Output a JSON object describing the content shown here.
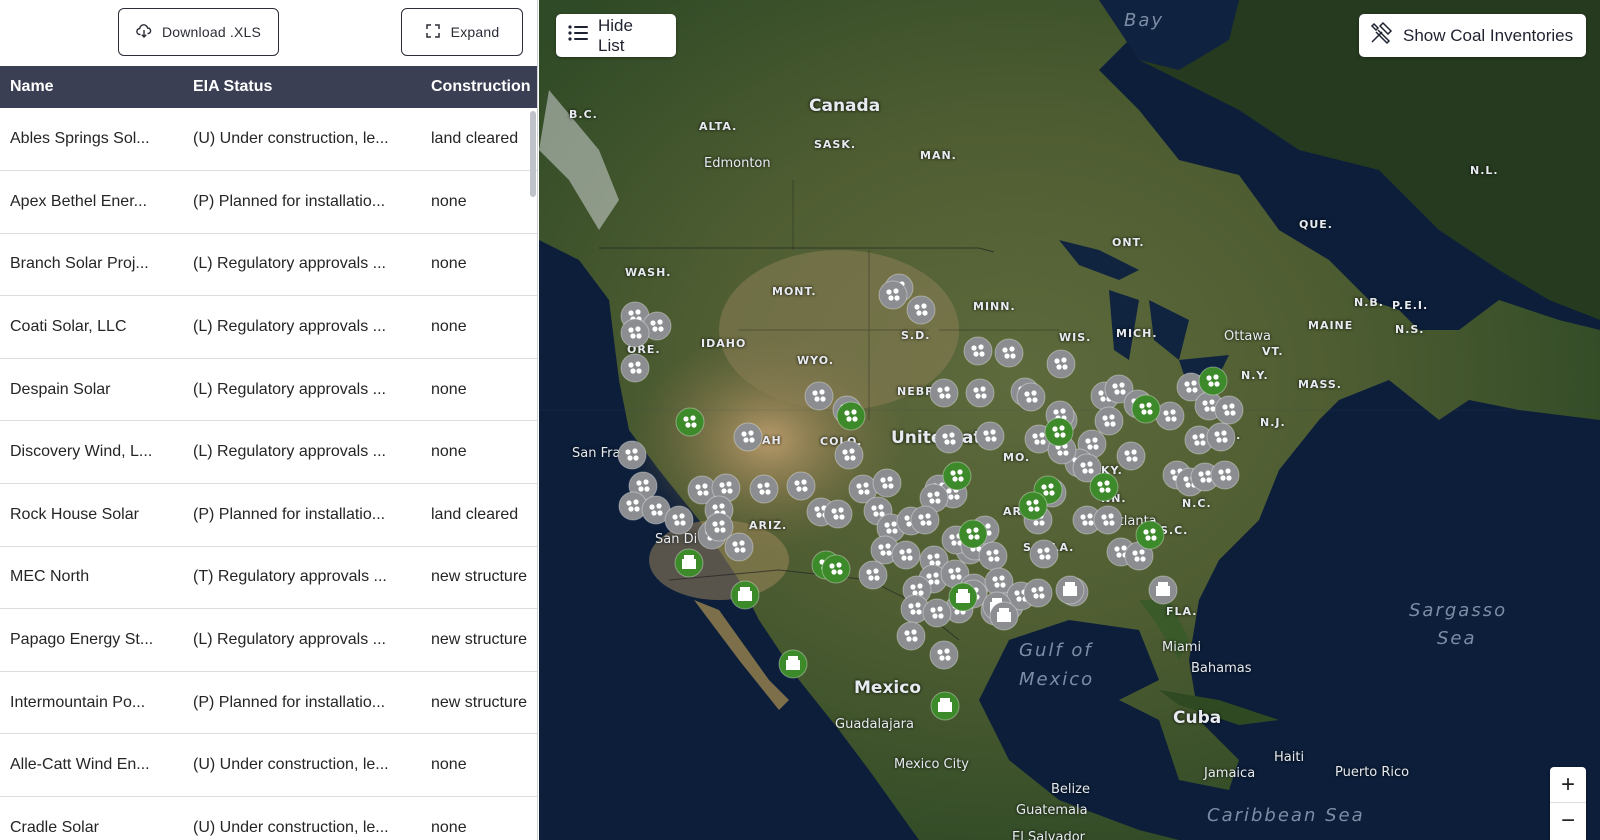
{
  "toolbar": {
    "download_label": "Download .XLS",
    "expand_label": "Expand"
  },
  "table": {
    "columns": [
      "Name",
      "EIA Status",
      "Construction"
    ],
    "rows": [
      {
        "name": "Ables Springs Sol...",
        "status": "(U) Under construction, le...",
        "construction": "land cleared"
      },
      {
        "name": "Apex Bethel Ener...",
        "status": "(P) Planned for installatio...",
        "construction": "none"
      },
      {
        "name": "Branch Solar Proj...",
        "status": "(L) Regulatory approvals ...",
        "construction": "none"
      },
      {
        "name": "Coati Solar, LLC",
        "status": "(L) Regulatory approvals ...",
        "construction": "none"
      },
      {
        "name": "Despain Solar",
        "status": "(L) Regulatory approvals ...",
        "construction": "none"
      },
      {
        "name": "Discovery Wind, L...",
        "status": "(L) Regulatory approvals ...",
        "construction": "none"
      },
      {
        "name": "Rock House Solar",
        "status": "(P) Planned for installatio...",
        "construction": "land cleared"
      },
      {
        "name": "MEC North",
        "status": "(T) Regulatory approvals ...",
        "construction": "new structure"
      },
      {
        "name": "Papago Energy St...",
        "status": "(L) Regulatory approvals ...",
        "construction": "new structure"
      },
      {
        "name": "Intermountain Po...",
        "status": "(P) Planned for installatio...",
        "construction": "new structure"
      },
      {
        "name": "Alle-Catt Wind En...",
        "status": "(U) Under construction, le...",
        "construction": "none"
      },
      {
        "name": "Cradle Solar",
        "status": "(U) Under construction, le...",
        "construction": "none"
      }
    ]
  },
  "map": {
    "hide_list_label": "Hide List",
    "coal_label": "Show Coal Inventories",
    "zoom_in": "+",
    "zoom_out": "−",
    "labels": {
      "bay": "Bay",
      "canada": "Canada",
      "bc": "B.C.",
      "alta": "ALTA.",
      "sask": "SASK.",
      "man": "MAN.",
      "edmonton": "Edmonton",
      "nl": "N.L.",
      "que": "QUE.",
      "ont": "ONT.",
      "wash": "WASH.",
      "mont": "MONT.",
      "idaho": "IDAHO",
      "ore": "ORE.",
      "wyo": "WYO.",
      "sd": "S.D.",
      "minn": "MINN.",
      "wis": "WIS.",
      "mich": "MICH.",
      "nebr": "NEBR",
      "colo": "COLO.",
      "utah": "AH",
      "united": "Unite",
      "states_tail": "at",
      "mo": "MO.",
      "ky": "KY.",
      "ny": "N.Y.",
      "mass": "MASS.",
      "vt": "VT.",
      "nb": "N.B.",
      "pei": "P.E.I.",
      "maine": "MAINE",
      "ns": "N.S.",
      "ottawa": "Ottawa",
      "nj": "N.J.",
      "md": "MD.",
      "nc": "N.C.",
      "sc": "S.C.",
      "tn": "NN.",
      "atlanta": "Atlanta",
      "ala": "S. ALA.",
      "ar": "AR",
      "ariz": "ARIZ.",
      "sanfran": "San Fra",
      "sandiego": "San Di",
      "fla": "FLA.",
      "gulf": "Gulf of",
      "mexico_sea": "Mexico",
      "mexico": "Mexico",
      "guadalajara": "Guadalajara",
      "mexicocity": "Mexico City",
      "miami": "Miami",
      "bahamas": "Bahamas",
      "cuba": "Cuba",
      "haiti": "Haiti",
      "jamaica": "Jamaica",
      "puertorico": "Puerto Rico",
      "belize": "Belize",
      "guatemala": "Guatemala",
      "elsalvador": "El Salvador",
      "sargasso": "Sargasso",
      "sargasso2": "Sea",
      "caribbean": "Caribbean Sea"
    }
  }
}
